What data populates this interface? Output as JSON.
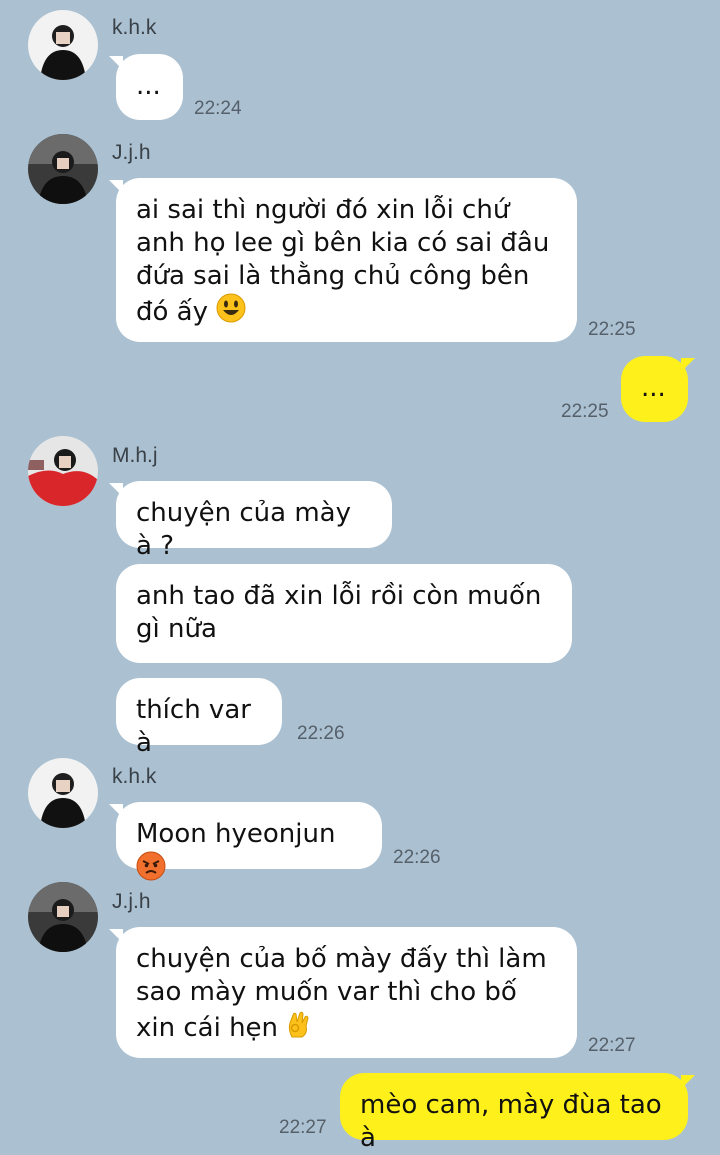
{
  "messages": [
    {
      "sender": "k.h.k",
      "text": "...",
      "time": "22:24"
    },
    {
      "sender": "J.j.h",
      "text": "ai sai thì người đó xin lỗi chứ anh họ lee gì bên kia có sai đâu đứa sai là thằng chủ công bên đó ấy",
      "emoji": "smiley-emoji",
      "time": "22:25"
    },
    {
      "sender": "me",
      "text": "...",
      "time": "22:25"
    },
    {
      "sender": "M.h.j",
      "text": "chuyện của mày à ?"
    },
    {
      "sender": "M.h.j",
      "text": "anh tao đã xin lỗi rồi còn muốn gì nữa"
    },
    {
      "sender": "M.h.j",
      "text": "thích var à",
      "time": "22:26"
    },
    {
      "sender": "k.h.k",
      "text": "Moon hyeonjun",
      "emoji": "angry-face-emoji",
      "time": "22:26"
    },
    {
      "sender": "J.j.h",
      "text": "chuyện của bố mày đấy thì làm sao mày muốn var thì cho bố xin cái hẹn",
      "emoji": "ok-hand-emoji",
      "time": "22:27"
    },
    {
      "sender": "me",
      "text": "mèo cam, mày đùa tao à",
      "time": "22:27"
    }
  ],
  "colors": {
    "background": "#abc1d1",
    "incoming_bubble": "#ffffff",
    "outgoing_bubble": "#fef01b"
  }
}
